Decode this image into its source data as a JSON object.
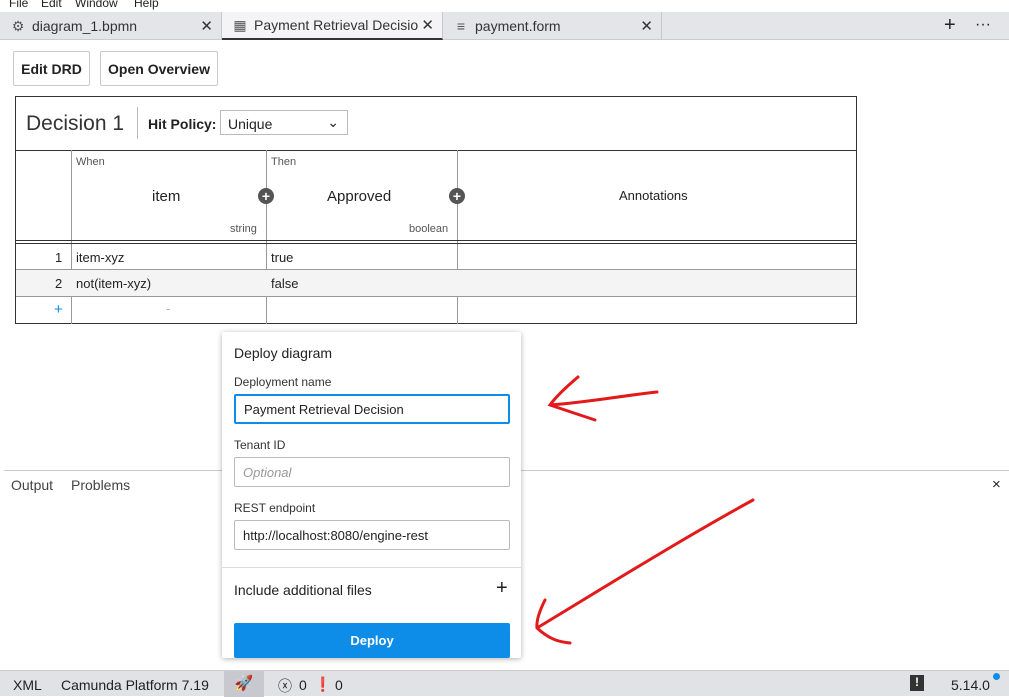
{
  "menu": [
    "File",
    "Edit",
    "Window",
    "Help"
  ],
  "tabs": [
    {
      "label": "diagram_1.bpmn",
      "icon": "gear-icon"
    },
    {
      "label": "Payment Retrieval Decisio",
      "icon": "table-icon"
    },
    {
      "label": "payment.form",
      "icon": "form-icon"
    }
  ],
  "toolbar": {
    "edit_drd": "Edit DRD",
    "open_overview": "Open Overview"
  },
  "decision": {
    "name": "Decision 1",
    "hit_policy_label": "Hit Policy:",
    "hit_policy": "Unique",
    "input": {
      "kind": "When",
      "label": "item",
      "type": "string"
    },
    "output": {
      "kind": "Then",
      "label": "Approved",
      "type": "boolean"
    },
    "annotations": "Annotations",
    "rows": [
      {
        "n": "1",
        "input": "item-xyz",
        "output": "true"
      },
      {
        "n": "2",
        "input": "not(item-xyz)",
        "output": "false"
      }
    ],
    "add_row": "+",
    "empty": "-"
  },
  "panel": {
    "output": "Output",
    "problems": "Problems",
    "close": "×"
  },
  "deploy": {
    "title": "Deploy diagram",
    "name_label": "Deployment name",
    "name_value": "Payment Retrieval Decision",
    "tenant_label": "Tenant ID",
    "tenant_placeholder": "Optional",
    "rest_label": "REST endpoint",
    "rest_value": "http://localhost:8080/engine-rest",
    "files_label": "Include additional files",
    "button": "Deploy",
    "accent": "#0d8ce8"
  },
  "status": {
    "xml": "XML",
    "platform": "Camunda Platform 7.19",
    "errors": "0",
    "warnings": "0",
    "version": "5.14.0"
  }
}
